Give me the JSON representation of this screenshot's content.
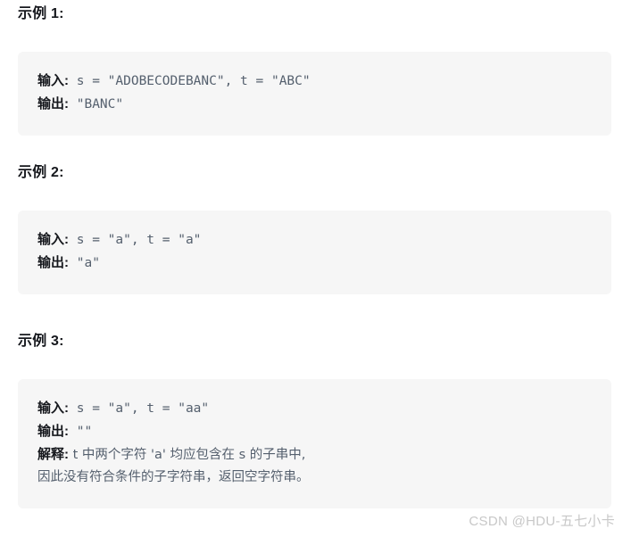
{
  "page": {
    "background": "#ffffff",
    "code_block_background": "#f6f6f6",
    "code_text_color": "#55606e",
    "label_color": "#16181d",
    "watermark_color": "#c8c8c8"
  },
  "examples": [
    {
      "heading": "示例 1:",
      "lines": [
        {
          "label": "输入:",
          "code": " s = \"ADOBECODEBANC\", t = \"ABC\""
        },
        {
          "label": "输出:",
          "code": " \"BANC\""
        }
      ]
    },
    {
      "heading": "示例 2:",
      "lines": [
        {
          "label": "输入:",
          "code": " s = \"a\", t = \"a\""
        },
        {
          "label": "输出:",
          "code": " \"a\""
        }
      ]
    },
    {
      "heading": "示例 3:",
      "lines": [
        {
          "label": "输入:",
          "code": " s = \"a\", t = \"aa\""
        },
        {
          "label": "输出:",
          "code": " \"\""
        },
        {
          "label": "解释:",
          "code": " t 中两个字符 'a' 均应包含在 s 的子串中,"
        },
        {
          "label": "",
          "code": "因此没有符合条件的子字符串，返回空字符串。"
        }
      ]
    }
  ],
  "watermark": {
    "text": "CSDN @HDU-五七小卡"
  }
}
